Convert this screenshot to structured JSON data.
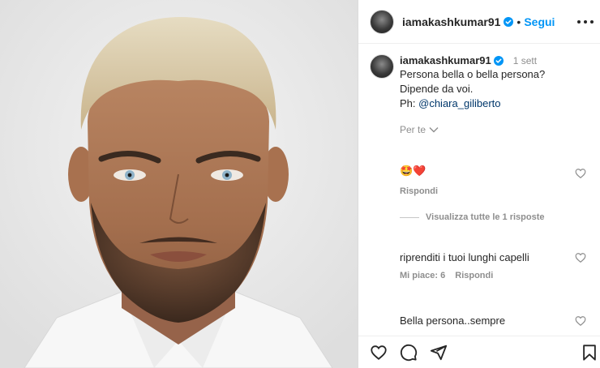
{
  "header": {
    "username": "iamakashkumar91",
    "separator": "•",
    "follow_label": "Segui",
    "more_icon": "more-horizontal-icon",
    "verified_icon": "verified-badge-icon"
  },
  "caption": {
    "username": "iamakashkumar91",
    "time": "1 sett",
    "text": "Persona bella o bella persona? Dipende da voi.",
    "credit_prefix": "Ph: ",
    "credit_mention": "@chiara_giliberto",
    "translate_label": "Per te"
  },
  "comments": [
    {
      "text": "🤩❤️",
      "reply_label": "Rispondi",
      "view_replies": "Visualizza tutte le 1 risposte"
    },
    {
      "text": "riprenditi i tuoi lunghi capelli",
      "likes_label": "Mi piace: 6",
      "reply_label": "Rispondi"
    },
    {
      "text": "Bella persona..sempre"
    }
  ],
  "actions": {
    "like_icon": "heart-icon",
    "comment_icon": "comment-icon",
    "share_icon": "send-icon",
    "save_icon": "bookmark-icon"
  },
  "colors": {
    "accent": "#0095f6",
    "mention": "#00376b",
    "secondary_text": "#8e8e8e",
    "primary_text": "#262626"
  }
}
